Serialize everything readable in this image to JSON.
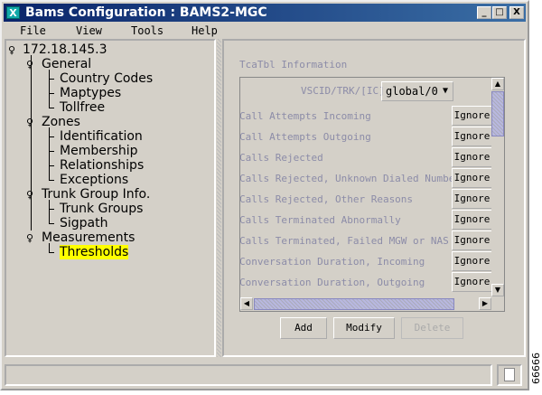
{
  "window": {
    "title": "Bams Configuration : BAMS2-MGC",
    "app_icon": "X",
    "controls": [
      "_",
      "□",
      "X"
    ]
  },
  "menu": [
    "File",
    "View",
    "Tools",
    "Help"
  ],
  "tree": {
    "root": "172.18.145.3",
    "items": [
      {
        "label": "General",
        "children": [
          "Country Codes",
          "Maptypes",
          "Tollfree"
        ]
      },
      {
        "label": "Zones",
        "children": [
          "Identification",
          "Membership",
          "Relationships",
          "Exceptions"
        ]
      },
      {
        "label": "Trunk Group Info.",
        "children": [
          "Trunk Groups",
          "Sigpath"
        ]
      },
      {
        "label": "Measurements",
        "children": [
          "Thresholds"
        ]
      }
    ],
    "selected": "Thresholds",
    "highlight_color": "#ffff00"
  },
  "panel": {
    "title": "TcaTbl Information",
    "selector_label": "VSCID/TRK/[IC]",
    "selector_value": "global/0",
    "rows": [
      {
        "label": "Call Attempts Incoming",
        "value": "Ignore"
      },
      {
        "label": "Call Attempts Outgoing",
        "value": "Ignore"
      },
      {
        "label": "Calls Rejected",
        "value": "Ignore"
      },
      {
        "label": "Calls Rejected, Unknown Dialed Number",
        "value": "Ignore"
      },
      {
        "label": "Calls Rejected, Other Reasons",
        "value": "Ignore"
      },
      {
        "label": "Calls Terminated Abnormally",
        "value": "Ignore"
      },
      {
        "label": "Calls Terminated, Failed MGW or NAS",
        "value": "Ignore"
      },
      {
        "label": "Conversation Duration, Incoming",
        "value": "Ignore"
      },
      {
        "label": "Conversation Duration, Outgoing",
        "value": "Ignore"
      }
    ],
    "buttons": {
      "add": "Add",
      "modify": "Modify",
      "delete": "Delete"
    }
  },
  "figure_id": "66666"
}
